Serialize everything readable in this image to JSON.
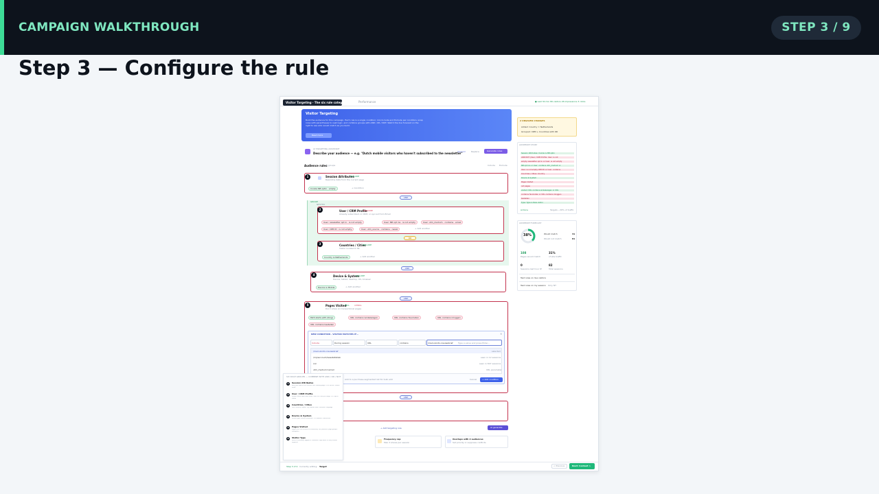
{
  "header": {
    "title": "CAMPAIGN WALKTHROUGH",
    "step": "STEP 3 / 9"
  },
  "slide_title": "Step 3 — Configure the rule",
  "colors": {
    "header_bg": "#0d131c",
    "accent_green": "#3ddc97",
    "rule_border": "#c3324d",
    "brand_blue": "#4f74f3",
    "primary_green": "#1fb87a"
  },
  "screenshot": {
    "topbar": {
      "tooltip": "Visitor Targeting · The six rule categories",
      "tab_performance": "Performance",
      "stats": "● Last 30 min   86 visitors   26 impressions   3 clicks"
    },
    "hero": {
      "title": "Visitor Targeting",
      "desc1": "Build the audience for this campaign. Each rule is a single condition; mix Include and Exclude per condition, wrap",
      "desc2": "rules with parentheses to nest logic, and combine groups with AND / OR / NOT. Watch the live forecast on the",
      "desc3": "right to see who would match as you build.",
      "button": "Read more"
    },
    "assistant": {
      "label": "AI TARGETING ASSISTANT",
      "prompt": "Describe your audience — e.g. \"Dutch mobile visitors who haven't subscribed to the newsletter\"",
      "append": "Append",
      "replace": "Replace",
      "generate": "Generate rules"
    },
    "audience": {
      "label": "Audience rules",
      "count": "5 groups",
      "include": "Include",
      "exclude": "Exclude"
    },
    "rules": [
      {
        "num": "1",
        "name": "Session Attributes",
        "tag": "INCLUDE",
        "sub": "Real-time data from the current page",
        "chip": "Cookie NB optin · empty",
        "add": "+ Condition"
      },
      {
        "num": "2",
        "name": "User / CRM Profile",
        "tag": "EXCLUDE",
        "sub": "Already subscribed, in CRM, or synced from Email",
        "chips": [
          "User: newsletter opt in · is not empty",
          "User: NB opt ins · is not empty",
          "User: utm_medium · contains · email",
          "User: CRM ID · is not empty",
          "User: utm_source · contains · newsl"
        ],
        "add": "+ Add another"
      },
      {
        "num": "3",
        "name": "Countries / Cities",
        "tag": "INCLUDE",
        "sub": "Visitor located in NL",
        "chip": "Country is Netherlands",
        "add": "+ Add another"
      },
      {
        "num": "4",
        "name": "Device & System",
        "tag": "INCLUDE",
        "sub": "Device, tablet, desktop, OS, browser",
        "chip": "Device is Mobile",
        "add": "+ Add another"
      },
      {
        "num": "5",
        "name": "Pages Visited",
        "tag": "INCL",
        "tag2": "4 EXCL",
        "sub": "Don't show on transactional pages",
        "chips": [
          "Path starts with /blog/",
          "URL contains winkelwagen",
          "URL contains favorieten",
          "URL contains inloggen",
          "URL contains bestellen"
        ]
      }
    ],
    "groups_label": "GROUP",
    "nested_label": "NESTED",
    "or": "OR",
    "and": "AND",
    "new_condition": {
      "title": "NEW CONDITION · VISITOR MATCHES IF...",
      "col_include": "Include",
      "col_scope": "During session",
      "col_field": "URL",
      "col_operator": "contains",
      "col_value": "/mein-konto-nieuwsbrief",
      "value_placeholder": "Type a value and press Enter...",
      "options": [
        {
          "value": "/mein-konto-nieuwsbrief",
          "note": "selected"
        },
        {
          "value": "/mijnaccount/wasstatistiek",
          "note": "seen in 12 sessions"
        },
        {
          "value": "/nl/",
          "note": "seen in 847 sessions"
        },
        {
          "value": "utm_medium=email",
          "note": "URL parameter"
        }
      ],
      "footer": "Add to a purchase-segmented list for bulk add",
      "cancel": "Cancel",
      "add": "+ Add condition"
    },
    "add_rule": "+ Add targeting rule",
    "ai_generate": "AI generate",
    "bottom_cards": [
      {
        "title": "Frequency cap",
        "sub": "Max 3 shows per session"
      },
      {
        "title": "Overlaps with 2 audiences",
        "sub": "Set priority or suppress conflicts"
      }
    ],
    "legend": {
      "title": "SIX RULE GROUPS — COMBINE WITH AND / OR / NOT",
      "items": [
        {
          "num": "1",
          "name": "Session Attributes",
          "desc": "Real-time data of the current visit: landing page, UTM, device, cookie, scroll"
        },
        {
          "num": "2",
          "name": "User / CRM Profile",
          "desc": "Known visitor data from email CRM/CDP: lifecycle stage, LTV, opt-in status"
        },
        {
          "num": "3",
          "name": "Countries / Cities",
          "desc": "Geo: country, region, city, postal code, timezone, language"
        },
        {
          "num": "4",
          "name": "Device & System",
          "desc": "Device type, screen resolution, OS, browser, connection"
        },
        {
          "num": "5",
          "name": "Pages Visited",
          "desc": "Pages seen this session or historically: URL patterns, page groups, categories"
        },
        {
          "num": "6",
          "name": "Visitor Type",
          "desc": "New vs returning, logged-in, customer, high-value, or any custom segment"
        }
      ]
    },
    "footer": {
      "step": "Step 3 of 4",
      "editing": "Currently editing:",
      "editing_value": "Target",
      "previous": "< Previous",
      "next": "Next: Content >"
    },
    "unsaved": {
      "title": "2 UNSAVED CHANGES",
      "line1": "Added: Country = Netherlands",
      "line2": "Grouped: CRM + Countries with OR"
    },
    "story": {
      "title": "AUDIENCE STORY",
      "lines": [
        "Session Attributes: Cookie is NB optin",
        "AND NOT (User / CRM Profile: User: is not",
        "empty newsletter opt in or User: is not empty",
        "NB opt ins or User: contains utm_medium or",
        "User: is not empty CRM ID or User: contains",
        "Countries / Cities: Country",
        "Device & System",
        "Pages Visited",
        "not pages",
        "visited: URL contains winkelwagen or URL",
        "contains favorieten or URL contains inloggen",
        "bestellen",
        "Type: Type is New visitor"
      ],
      "actions": "Actions",
      "targets": "Targets ~38% of traffic"
    },
    "forecast": {
      "title": "AUDIENCE FORECAST",
      "percent_value": 38,
      "percent_label": "38%",
      "would_match": "Would match",
      "would_match_val": "31",
      "would_not": "Would not match",
      "would_not_val": "81",
      "stat1_val": "108",
      "stat1_label": "Pages would match",
      "stat2_val": "31%",
      "stat2_label": "of site traffic",
      "stat3_val": "0",
      "stat3_label": "Sessions last hour IP",
      "stat4_val": "82",
      "stat4_label": "Total sessions",
      "test1": "Test rules on live visitors",
      "test2": "Test rules on my session",
      "test2_meta": "Only NT"
    }
  }
}
